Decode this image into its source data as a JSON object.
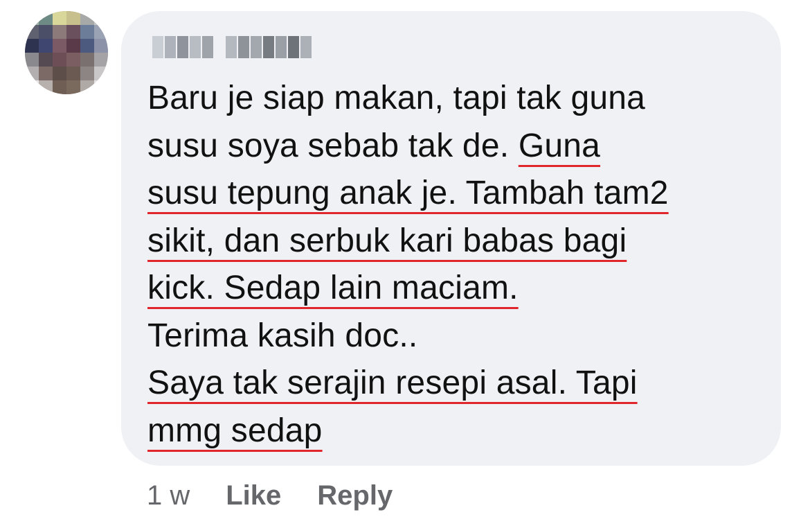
{
  "comment": {
    "author_name": "",
    "lines": [
      {
        "segments": [
          {
            "text": "Baru je siap makan, tapi tak guna",
            "underline": false
          }
        ]
      },
      {
        "segments": [
          {
            "text": "susu soya sebab tak de. ",
            "underline": false
          },
          {
            "text": "Guna",
            "underline": true
          }
        ]
      },
      {
        "segments": [
          {
            "text": "susu tepung anak je. Tambah tam2",
            "underline": true
          }
        ]
      },
      {
        "segments": [
          {
            "text": "sikit, dan serbuk kari babas bagi",
            "underline": true
          }
        ]
      },
      {
        "segments": [
          {
            "text": "kick. Sedap lain maciam.",
            "underline": true
          }
        ]
      },
      {
        "segments": [
          {
            "text": "Terima kasih doc..",
            "underline": false
          }
        ]
      },
      {
        "segments": [
          {
            "text": "Saya tak serajin resepi asal. Tapi",
            "underline": true
          }
        ]
      },
      {
        "segments": [
          {
            "text": "mmg sedap",
            "underline": true
          }
        ]
      }
    ]
  },
  "actions": {
    "timestamp": "1 w",
    "like_label": "Like",
    "reply_label": "Reply"
  },
  "colors": {
    "bubble_background": "#f0f1f5",
    "text": "#111111",
    "meta_text": "#65676b",
    "underline": "#e0262b"
  },
  "avatar": {
    "pixel_colors": [
      "#9fb2a8",
      "#6d8a84",
      "#d9d79a",
      "#c8c08c",
      "#a7a8a8",
      "#c4c5c6",
      "#5f6070",
      "#4b4f68",
      "#8c7a7a",
      "#6a4f5c",
      "#6b7d98",
      "#9aa3b3",
      "#2e3350",
      "#3f4770",
      "#7b5a66",
      "#5a3a48",
      "#4c5a80",
      "#8c93a8",
      "#8a8a8e",
      "#564a52",
      "#6d4d56",
      "#7a5e62",
      "#7a7070",
      "#a6a3a6",
      "#b3aeb0",
      "#7c6a66",
      "#5e4e4a",
      "#6a5a52",
      "#8c8583",
      "#c9c7c8",
      "#e8e6e6",
      "#b8b0ac",
      "#6e5e54",
      "#7a6a5e",
      "#b0aaa6",
      "#e6e4e4"
    ]
  },
  "author_blur": {
    "block_colors": [
      [
        "#c9cdd4",
        "#aeb2bb",
        "#8f939b",
        "#b8bcc3",
        "#9fa3aa"
      ],
      [
        "#b4b8bf",
        "#8e9299",
        "#a3a7ae",
        "#777b82",
        "#9b9fa6",
        "#6e7279",
        "#acb0b7"
      ]
    ]
  }
}
